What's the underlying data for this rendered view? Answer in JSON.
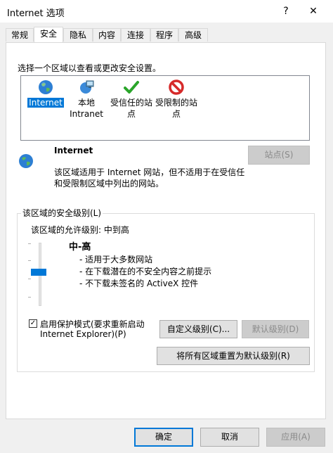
{
  "window": {
    "title": "Internet 选项",
    "help": "?",
    "close": "✕"
  },
  "tabs": [
    {
      "label": "常规"
    },
    {
      "label": "安全"
    },
    {
      "label": "隐私"
    },
    {
      "label": "内容"
    },
    {
      "label": "连接"
    },
    {
      "label": "程序"
    },
    {
      "label": "高级"
    }
  ],
  "zones": {
    "prompt": "选择一个区域以查看或更改安全设置。",
    "items": [
      {
        "line1": "Internet",
        "line2": "",
        "icon": "globe-icon"
      },
      {
        "line1": "本地",
        "line2": "Intranet",
        "icon": "intranet-icon"
      },
      {
        "line1": "受信任的站",
        "line2": "点",
        "icon": "check-icon"
      },
      {
        "line1": "受限制的站",
        "line2": "点",
        "icon": "restricted-icon"
      }
    ]
  },
  "zone_info": {
    "name": "Internet",
    "desc_line1": "该区域适用于 Internet 网站，但不适用于在受信任",
    "desc_line2": "和受限制区域中列出的网站。",
    "sites_button": "站点(S)"
  },
  "security_level": {
    "group_title": "该区域的安全级别(L)",
    "allowed": "该区域的允许级别: 中到高",
    "level_name": "中-高",
    "bullets": [
      "- 适用于大多数网站",
      "- 在下载潜在的不安全内容之前提示",
      "- 不下载未签名的 ActiveX 控件"
    ],
    "protected_mode_line1": "启用保护模式(要求重新启动",
    "protected_mode_line2": "Internet Explorer)(P)",
    "protected_mode_checked": true,
    "custom_button": "自定义级别(C)...",
    "default_button": "默认级别(D)",
    "reset_all_button": "将所有区域重置为默认级别(R)"
  },
  "footer": {
    "ok": "确定",
    "cancel": "取消",
    "apply": "应用(A)"
  }
}
